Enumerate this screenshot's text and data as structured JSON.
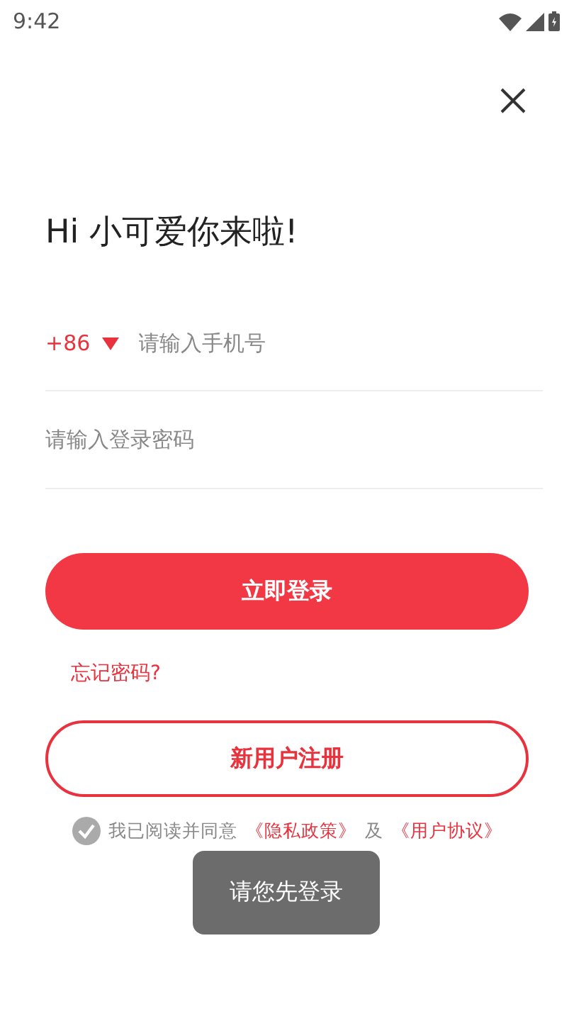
{
  "status_bar": {
    "time": "9:42"
  },
  "title": "Hi 小可爱你来啦!",
  "phone": {
    "country_code": "+86",
    "placeholder": "请输入手机号"
  },
  "password": {
    "placeholder": "请输入登录密码"
  },
  "login_button": "立即登录",
  "forgot_link": "忘记密码?",
  "register_button": "新用户注册",
  "agreement": {
    "checked": false,
    "text": "我已阅读并同意",
    "privacy_link": "《隐私政策》",
    "joiner": "及",
    "terms_link": "《用户协议》"
  },
  "toast": "请您先登录"
}
